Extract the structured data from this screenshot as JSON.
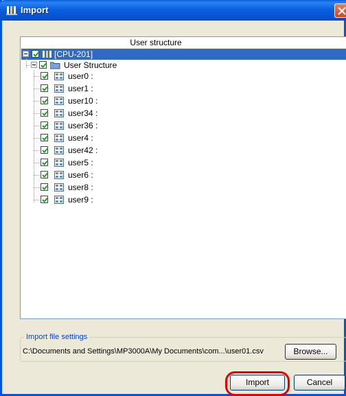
{
  "window": {
    "title": "Import"
  },
  "tree": {
    "column_header": "User structure",
    "root": {
      "label": "[CPU-201]",
      "checked": true
    },
    "group": {
      "label": "User Structure",
      "checked": true
    },
    "items": [
      {
        "label": "user0 :"
      },
      {
        "label": "user1 :"
      },
      {
        "label": "user10 :"
      },
      {
        "label": "user34 :"
      },
      {
        "label": "user36 :"
      },
      {
        "label": "user4 :"
      },
      {
        "label": "user42 :"
      },
      {
        "label": "user5 :"
      },
      {
        "label": "user6 :"
      },
      {
        "label": "user8 :"
      },
      {
        "label": "user9 :"
      }
    ]
  },
  "import_settings": {
    "group_title": "Import file settings",
    "file_path": "C:\\Documents and Settings\\MP3000A\\My Documents\\com...\\user01.csv",
    "browse_label": "Browse..."
  },
  "buttons": {
    "import_label": "Import",
    "cancel_label": "Cancel"
  },
  "colors": {
    "title_bar": "#0b60e0",
    "selection": "#316ac5",
    "highlight_ring": "#e60000"
  }
}
